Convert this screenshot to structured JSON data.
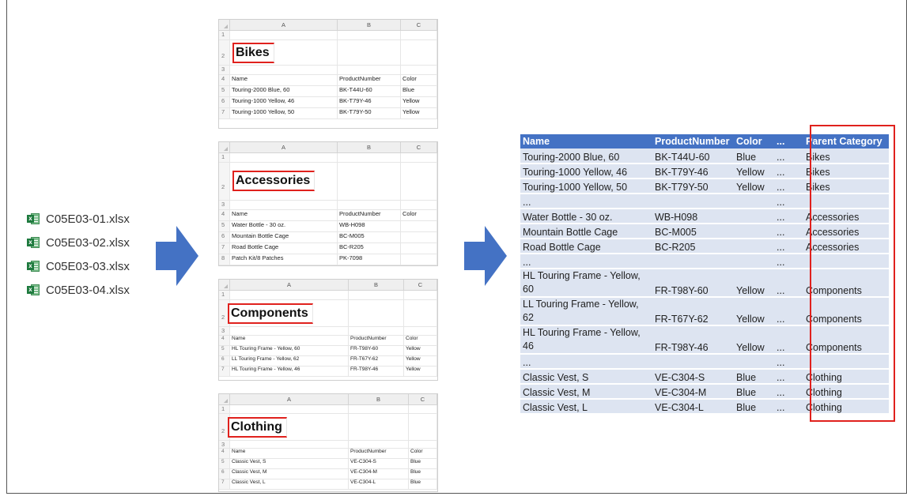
{
  "files": [
    {
      "name": "C05E03-01.xlsx",
      "icon": "excel-file-icon"
    },
    {
      "name": "C05E03-02.xlsx",
      "icon": "excel-file-icon"
    },
    {
      "name": "C05E03-03.xlsx",
      "icon": "excel-file-icon"
    },
    {
      "name": "C05E03-04.xlsx",
      "icon": "excel-file-icon"
    }
  ],
  "colors": {
    "arrow": "#4472c4",
    "highlight": "#e0211d",
    "header": "#4472c4",
    "row": "#dde4f1"
  },
  "sheets": [
    {
      "title": "Bikes",
      "columns": [
        "A",
        "B",
        "C"
      ],
      "headers": [
        "Name",
        "ProductNumber",
        "Color"
      ],
      "rows": [
        [
          "Touring-2000 Blue, 60",
          "BK-T44U-60",
          "Blue"
        ],
        [
          "Touring-1000 Yellow, 46",
          "BK-T79Y-46",
          "Yellow"
        ],
        [
          "Touring-1000 Yellow, 50",
          "BK-T79Y-50",
          "Yellow"
        ]
      ]
    },
    {
      "title": "Accessories",
      "columns": [
        "A",
        "B",
        "C"
      ],
      "headers": [
        "Name",
        "ProductNumber",
        "Color"
      ],
      "rows": [
        [
          "Water Bottle - 30 oz.",
          "WB-H098",
          ""
        ],
        [
          "Mountain Bottle Cage",
          "BC-M005",
          ""
        ],
        [
          "Road Bottle Cage",
          "BC-R205",
          ""
        ],
        [
          "Patch Kit/8 Patches",
          "PK-7098",
          ""
        ]
      ]
    },
    {
      "title": "Components",
      "columns": [
        "A",
        "B",
        "C"
      ],
      "headers": [
        "Name",
        "ProductNumber",
        "Color"
      ],
      "rows": [
        [
          "HL Touring Frame - Yellow, 60",
          "FR-T98Y-60",
          "Yellow"
        ],
        [
          "LL Touring Frame - Yellow, 62",
          "FR-T67Y-62",
          "Yellow"
        ],
        [
          "HL Touring Frame - Yellow, 46",
          "FR-T98Y-46",
          "Yellow"
        ]
      ]
    },
    {
      "title": "Clothing",
      "columns": [
        "A",
        "B",
        "C"
      ],
      "headers": [
        "Name",
        "ProductNumber",
        "Color"
      ],
      "rows": [
        [
          "Classic Vest, S",
          "VE-C304-S",
          "Blue"
        ],
        [
          "Classic Vest, M",
          "VE-C304-M",
          "Blue"
        ],
        [
          "Classic Vest, L",
          "VE-C304-L",
          "Blue"
        ]
      ]
    }
  ],
  "result": {
    "headers": [
      "Name",
      "ProductNumber",
      "Color",
      "...",
      "Parent Category"
    ],
    "rows": [
      [
        "Touring-2000 Blue, 60",
        "BK-T44U-60",
        "Blue",
        "...",
        "Bikes"
      ],
      [
        "Touring-1000 Yellow, 46",
        "BK-T79Y-46",
        "Yellow",
        "...",
        "Bikes"
      ],
      [
        "Touring-1000 Yellow, 50",
        "BK-T79Y-50",
        "Yellow",
        "...",
        "Bikes"
      ],
      [
        "...",
        "",
        "",
        "...",
        ""
      ],
      [
        "Water Bottle - 30 oz.",
        "WB-H098",
        "",
        "...",
        "Accessories"
      ],
      [
        "Mountain Bottle Cage",
        "BC-M005",
        "",
        "...",
        "Accessories"
      ],
      [
        "Road Bottle Cage",
        "BC-R205",
        "",
        "...",
        "Accessories"
      ],
      [
        "...",
        "",
        "",
        "...",
        ""
      ],
      [
        "HL Touring Frame - Yellow, 60",
        "FR-T98Y-60",
        "Yellow",
        "...",
        "Components"
      ],
      [
        "LL Touring Frame - Yellow, 62",
        "FR-T67Y-62",
        "Yellow",
        "...",
        "Components"
      ],
      [
        "HL Touring Frame - Yellow, 46",
        "FR-T98Y-46",
        "Yellow",
        "...",
        "Components"
      ],
      [
        "...",
        "",
        "",
        "...",
        ""
      ],
      [
        "Classic Vest, S",
        "VE-C304-S",
        "Blue",
        "...",
        "Clothing"
      ],
      [
        "Classic Vest, M",
        "VE-C304-M",
        "Blue",
        "...",
        "Clothing"
      ],
      [
        "Classic Vest, L",
        "VE-C304-L",
        "Blue",
        "...",
        "Clothing"
      ]
    ]
  }
}
